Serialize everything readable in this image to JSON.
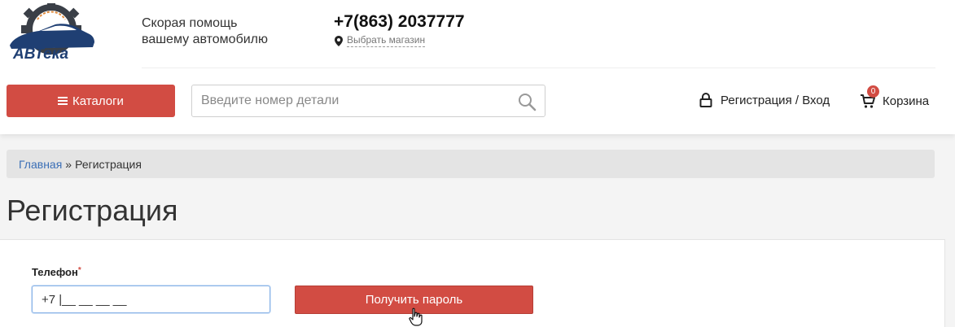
{
  "header": {
    "logo_text": "АВТека",
    "tagline_line1": "Скорая помощь",
    "tagline_line2": "вашему автомобилю",
    "phone": "+7(863) 2037777",
    "store_link": "Выбрать магазин",
    "catalog_button": "Каталоги",
    "search_placeholder": "Введите номер детали",
    "login_label": "Регистрация / Вход",
    "cart_label": "Корзина",
    "cart_count": "0"
  },
  "breadcrumb": {
    "home": "Главная",
    "separator": "»",
    "current": "Регистрация"
  },
  "page": {
    "title": "Регистрация"
  },
  "form": {
    "phone_label": "Телефон",
    "required_mark": "*",
    "phone_value": "+7 |__ __ __ __",
    "submit_label": "Получить пароль"
  },
  "colors": {
    "accent": "#d24c43",
    "link": "#3b6fb6",
    "logo_blue": "#1f3f73"
  },
  "icons": [
    "gear-car-logo",
    "burger-icon",
    "search-icon",
    "map-pin-icon",
    "lock-icon",
    "cart-icon",
    "hand-cursor-icon"
  ]
}
